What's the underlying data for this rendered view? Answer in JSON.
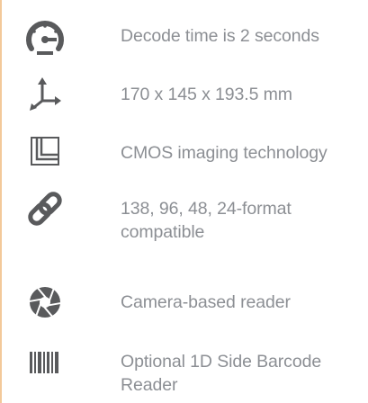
{
  "features": [
    {
      "icon": "speedometer-icon",
      "text": "Decode time is 2 seconds"
    },
    {
      "icon": "dimensions-axes-icon",
      "text": "170 x 145 x 193.5 mm"
    },
    {
      "icon": "imaging-frame-icon",
      "text": "CMOS imaging technology"
    },
    {
      "icon": "chain-link-icon",
      "text": "138, 96, 48, 24-format",
      "text2": "compatible"
    },
    {
      "icon": "camera-aperture-icon",
      "text": "Camera-based reader"
    },
    {
      "icon": "barcode-icon",
      "text": "Optional 1D Side Barcode",
      "text2": "Reader"
    }
  ],
  "colors": {
    "icon": "#595a5c",
    "text": "#8c8f94",
    "accent_rule": "#f3c99a"
  }
}
